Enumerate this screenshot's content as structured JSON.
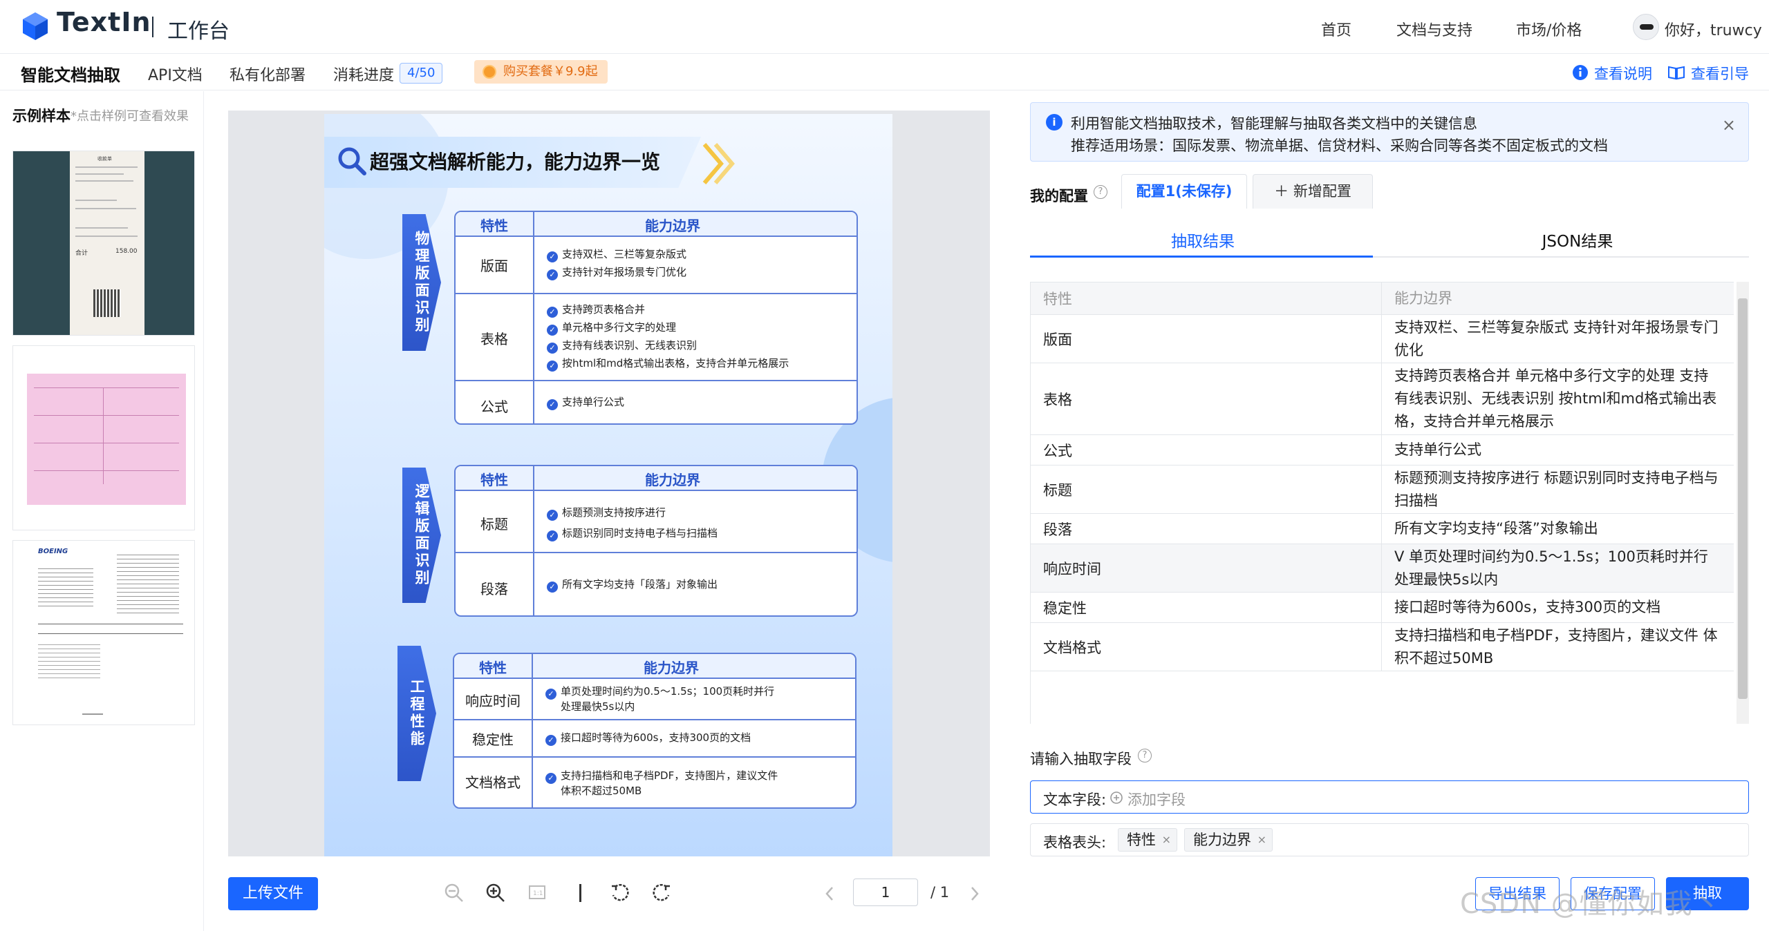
{
  "header": {
    "logo_text": "TextIn",
    "logo_sub": "工作台",
    "nav": [
      "首页",
      "文档与支持",
      "市场/价格"
    ],
    "user": "你好，truwcy"
  },
  "subnav": {
    "active": "智能文档抽取",
    "items": [
      "API文档",
      "私有化部署",
      "消耗进度"
    ],
    "progress": "4/50",
    "promo": "购买套餐￥9.9起",
    "help1": "查看说明",
    "help2": "查看引导"
  },
  "samples": {
    "title": "示例样本",
    "hint": "*点击样例可查看效果",
    "receipt_text": [
      "收款单",
      "合计",
      "158.00"
    ],
    "boeing_text": "BOEING"
  },
  "document": {
    "title": "超强文档解析能力，能力边界一览",
    "head_key": "特性",
    "head_val": "能力边界",
    "sections": [
      {
        "label": "物理版面识别",
        "rows": [
          {
            "k": "版面",
            "v": [
              "支持双栏、三栏等复杂版式",
              "支持针对年报场景专门优化"
            ]
          },
          {
            "k": "表格",
            "v": [
              "支持跨页表格合并",
              "单元格中多行文字的处理",
              "支持有线表识别、无线表识别",
              "按html和md格式输出表格，支持合并单元格展示"
            ]
          },
          {
            "k": "公式",
            "v": [
              "支持单行公式"
            ]
          }
        ]
      },
      {
        "label": "逻辑版面识别",
        "rows": [
          {
            "k": "标题",
            "v": [
              "标题预测支持按序进行",
              "标题识别同时支持电子档与扫描档"
            ]
          },
          {
            "k": "段落",
            "v": [
              "所有文字均支持「段落」对象输出"
            ]
          }
        ]
      },
      {
        "label": "工程性能",
        "rows": [
          {
            "k": "响应时间",
            "v": [
              "单页处理时间约为0.5～1.5s；100页耗时并行",
              "处理最快5s以内"
            ]
          },
          {
            "k": "稳定性",
            "v": [
              "接口超时等待为600s，支持300页的文档"
            ]
          },
          {
            "k": "文档格式",
            "v": [
              "支持扫描档和电子档PDF，支持图片，建议文件",
              "体积不超过50MB"
            ]
          }
        ]
      }
    ]
  },
  "toolbar": {
    "upload": "上传文件",
    "page": "1",
    "total": "/ 1"
  },
  "notice": {
    "line1": "利用智能文档抽取技术，智能理解与抽取各类文档中的关键信息",
    "line2": "推荐适用场景：国际发票、物流单据、信贷材料、采购合同等各类不固定板式的文档"
  },
  "config": {
    "label": "我的配置",
    "tab_active": "配置1(未保存)",
    "tab_new": "新增配置"
  },
  "result_tabs": [
    "抽取结果",
    "JSON结果"
  ],
  "result_table": {
    "headers": [
      "特性",
      "能力边界"
    ],
    "rows": [
      [
        "版面",
        "支持双栏、三栏等复杂版式 支持针对年报场景专门优化"
      ],
      [
        "表格",
        "支持跨页表格合并 单元格中多行文字的处理 支持有线表识别、无线表识别 按html和md格式输出表格，支持合并单元格展示"
      ],
      [
        "公式",
        "支持单行公式"
      ],
      [
        "标题",
        "标题预测支持按序进行 标题识别同时支持电子档与扫描档"
      ],
      [
        "段落",
        "所有文字均支持“段落”对象输出"
      ],
      [
        "响应时间",
        "V 单页处理时间约为0.5～1.5s；100页耗时并行 处理最快5s以内"
      ],
      [
        "稳定性",
        "接口超时等待为600s，支持300页的文档"
      ],
      [
        "文档格式",
        "支持扫描档和电子档PDF，支持图片，建议文件 体积不超过50MB"
      ]
    ]
  },
  "fields": {
    "label": "请输入抽取字段",
    "text_label": "文本字段:",
    "add_placeholder": "添加字段",
    "table_label": "表格表头:",
    "chips": [
      "特性",
      "能力边界"
    ]
  },
  "actions": {
    "export": "导出结果",
    "save": "保存配置",
    "extract": "抽取"
  },
  "watermark": "CSDN @懂你如我丶"
}
